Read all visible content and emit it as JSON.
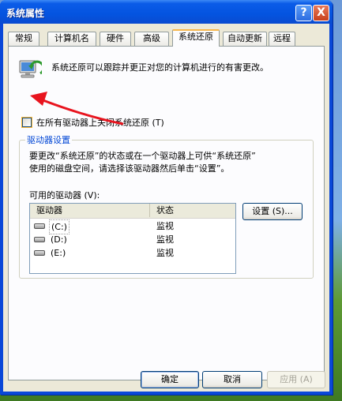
{
  "window": {
    "title": "系统属性"
  },
  "titlebar_buttons": {
    "help": "?",
    "close": "X"
  },
  "tabs": [
    {
      "label": "常规"
    },
    {
      "label": "计算机名"
    },
    {
      "label": "硬件"
    },
    {
      "label": "高级"
    },
    {
      "label": "系统还原"
    },
    {
      "label": "自动更新"
    },
    {
      "label": "远程"
    }
  ],
  "system_restore": {
    "intro": "系统还原可以跟踪并更正对您的计算机进行的有害更改。",
    "disable_all_label": "在所有驱动器上关闭系统还原 (T)",
    "disable_all_checked": false,
    "group": {
      "title": "驱动器设置",
      "description_1": "要更改“系统还原”的状态或在一个驱动器上可供“系统还原”",
      "description_2": "使用的磁盘空间，请选择该驱动器然后单击“设置”。",
      "drives_label": "可用的驱动器 (V):",
      "columns": {
        "drive": "驱动器",
        "status": "状态"
      },
      "drives": [
        {
          "name": "(C:)",
          "status": "监视"
        },
        {
          "name": "(D:)",
          "status": "监视"
        },
        {
          "name": "(E:)",
          "status": "监视"
        }
      ],
      "settings_button": "设置 (S)..."
    }
  },
  "dialog_buttons": {
    "ok": "确定",
    "cancel": "取消",
    "apply": "应用 (A)"
  },
  "colors": {
    "accent": "#0a48d8",
    "annotation_arrow": "#e8141e",
    "group_title": "#0046d5"
  },
  "icons": [
    "help-icon",
    "close-icon",
    "system-restore-icon",
    "disk-drive-icon"
  ]
}
